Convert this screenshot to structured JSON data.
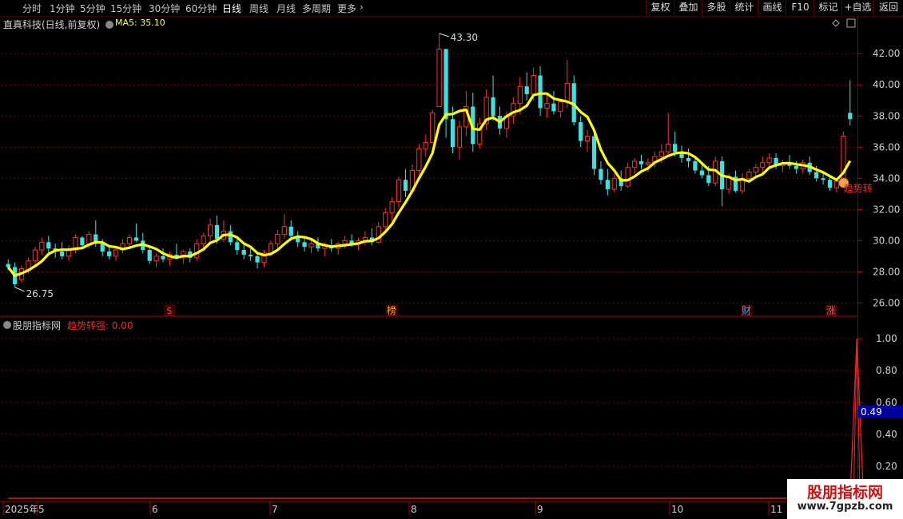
{
  "toolbar": {
    "timeframes": [
      "分时",
      "1分钟",
      "5分钟",
      "15分钟",
      "30分钟",
      "60分钟",
      "日线",
      "周线",
      "月线",
      "多周期",
      "更多"
    ],
    "active_timeframe": "日线",
    "actions": [
      "复权",
      "叠加",
      "多股",
      "统计",
      "画线",
      "F10",
      "标记",
      "+自选",
      "返回"
    ]
  },
  "main_panel": {
    "title": "直真科技(日线,前复权)",
    "ma_label": "MA5: 35.10",
    "high_label": "43.30",
    "low_label": "26.75",
    "markers": [
      {
        "text": "$",
        "color": "#ff3030"
      },
      {
        "text": "榜",
        "color": "#ffaa33"
      },
      {
        "text": "财",
        "color": "#33aaff"
      },
      {
        "text": "涨",
        "color": "#ff5050"
      }
    ],
    "signal_text": "趋势转"
  },
  "sub_panel": {
    "title": "股朋指标网",
    "indicator_label": "趋势转强: 0.00",
    "cursor_value": "0.49"
  },
  "watermark": {
    "title": "股朋指标网",
    "url": "www.7gpzb.com"
  },
  "colors": {
    "up": "#ff3030",
    "down": "#40e0e0",
    "ma": "#ffff00",
    "grid": "#7a0000",
    "axis_text": "#d0d0d0"
  },
  "chart_data": [
    {
      "type": "candlestick",
      "title": "直真科技(日线,前复权)",
      "ylim": [
        25.2,
        43.6
      ],
      "y_ticks": [
        26.0,
        28.0,
        30.0,
        32.0,
        34.0,
        36.0,
        38.0,
        40.0,
        42.0
      ],
      "x_labels": [
        "2025年",
        "5",
        "6",
        "7",
        "8",
        "9",
        "10",
        "11"
      ],
      "ohlc": [
        [
          28.5,
          28.8,
          28.1,
          28.3
        ],
        [
          28.3,
          28.6,
          27.0,
          27.2
        ],
        [
          27.5,
          28.4,
          27.3,
          28.2
        ],
        [
          28.1,
          28.9,
          27.9,
          28.7
        ],
        [
          28.7,
          29.6,
          28.5,
          29.4
        ],
        [
          29.4,
          30.2,
          29.1,
          29.9
        ],
        [
          29.9,
          30.3,
          29.2,
          29.5
        ],
        [
          29.5,
          29.8,
          28.9,
          29.3
        ],
        [
          29.3,
          29.9,
          28.8,
          29.0
        ],
        [
          29.0,
          29.7,
          28.7,
          29.4
        ],
        [
          29.4,
          30.4,
          29.2,
          30.2
        ],
        [
          30.2,
          30.3,
          29.5,
          29.7
        ],
        [
          29.7,
          30.6,
          29.5,
          30.4
        ],
        [
          30.4,
          31.3,
          29.6,
          29.8
        ],
        [
          29.8,
          30.1,
          29.0,
          29.3
        ],
        [
          29.3,
          29.7,
          28.8,
          29.0
        ],
        [
          29.0,
          29.6,
          28.7,
          29.4
        ],
        [
          29.4,
          30.1,
          29.2,
          29.8
        ],
        [
          29.8,
          30.4,
          29.5,
          30.2
        ],
        [
          30.2,
          31.1,
          29.9,
          30.0
        ],
        [
          30.0,
          30.5,
          29.2,
          29.4
        ],
        [
          29.4,
          29.6,
          28.5,
          28.7
        ],
        [
          28.7,
          29.2,
          28.3,
          29.0
        ],
        [
          29.0,
          29.5,
          28.6,
          28.8
        ],
        [
          28.8,
          29.3,
          28.4,
          29.1
        ],
        [
          29.1,
          29.8,
          28.8,
          28.9
        ],
        [
          28.9,
          29.4,
          28.5,
          29.3
        ],
        [
          29.3,
          29.5,
          28.6,
          28.9
        ],
        [
          28.9,
          30.1,
          28.7,
          29.8
        ],
        [
          29.8,
          30.5,
          29.5,
          30.3
        ],
        [
          30.3,
          31.4,
          30.0,
          31.0
        ],
        [
          31.0,
          31.6,
          29.8,
          30.1
        ],
        [
          30.1,
          31.3,
          29.9,
          30.6
        ],
        [
          30.6,
          31.0,
          29.7,
          29.9
        ],
        [
          29.9,
          30.2,
          29.1,
          29.4
        ],
        [
          29.4,
          29.9,
          28.8,
          29.1
        ],
        [
          29.1,
          29.5,
          28.7,
          29.0
        ],
        [
          29.0,
          29.3,
          28.2,
          28.6
        ],
        [
          28.6,
          29.4,
          28.3,
          29.2
        ],
        [
          29.2,
          30.0,
          29.0,
          29.8
        ],
        [
          29.8,
          30.7,
          29.5,
          30.4
        ],
        [
          30.4,
          31.7,
          30.1,
          30.9
        ],
        [
          30.9,
          31.3,
          30.0,
          30.3
        ],
        [
          30.3,
          30.6,
          29.6,
          29.9
        ],
        [
          29.9,
          30.3,
          29.3,
          29.6
        ],
        [
          29.6,
          30.1,
          29.2,
          29.8
        ],
        [
          29.8,
          30.2,
          29.3,
          29.5
        ],
        [
          29.5,
          29.9,
          29.0,
          29.7
        ],
        [
          29.7,
          30.1,
          29.3,
          29.5
        ],
        [
          29.5,
          29.9,
          29.1,
          29.8
        ],
        [
          29.8,
          30.3,
          29.5,
          30.0
        ],
        [
          30.0,
          30.4,
          29.6,
          29.8
        ],
        [
          29.8,
          30.2,
          29.4,
          30.0
        ],
        [
          30.0,
          30.6,
          29.7,
          30.2
        ],
        [
          30.2,
          30.8,
          29.7,
          29.9
        ],
        [
          29.9,
          31.2,
          29.8,
          30.9
        ],
        [
          30.9,
          32.1,
          30.6,
          31.8
        ],
        [
          31.8,
          32.8,
          31.2,
          32.5
        ],
        [
          32.5,
          34.1,
          32.1,
          33.9
        ],
        [
          33.9,
          34.6,
          32.8,
          33.2
        ],
        [
          33.2,
          34.9,
          33.0,
          34.5
        ],
        [
          34.5,
          36.2,
          34.2,
          35.9
        ],
        [
          35.9,
          36.8,
          35.4,
          36.3
        ],
        [
          36.3,
          38.4,
          37.8,
          38.2
        ],
        [
          38.6,
          43.3,
          39.8,
          42.3
        ],
        [
          42.3,
          42.3,
          36.6,
          37.8
        ],
        [
          37.8,
          38.6,
          35.6,
          36.0
        ],
        [
          36.0,
          37.7,
          35.2,
          37.3
        ],
        [
          37.3,
          39.6,
          36.7,
          38.6
        ],
        [
          38.6,
          39.5,
          35.7,
          36.2
        ],
        [
          36.2,
          37.9,
          35.9,
          37.5
        ],
        [
          37.5,
          39.7,
          37.1,
          39.2
        ],
        [
          39.2,
          40.6,
          37.7,
          38.0
        ],
        [
          38.0,
          38.6,
          36.8,
          37.2
        ],
        [
          37.2,
          38.3,
          36.6,
          38.0
        ],
        [
          38.0,
          39.2,
          37.5,
          38.8
        ],
        [
          38.8,
          40.5,
          38.1,
          39.9
        ],
        [
          39.9,
          40.8,
          39.0,
          39.4
        ],
        [
          39.4,
          41.1,
          39.0,
          40.6
        ],
        [
          40.6,
          41.2,
          38.0,
          38.5
        ],
        [
          38.5,
          39.4,
          37.9,
          38.8
        ],
        [
          38.8,
          39.6,
          38.1,
          38.3
        ],
        [
          38.3,
          39.1,
          37.9,
          38.9
        ],
        [
          38.9,
          41.6,
          38.5,
          40.1
        ],
        [
          40.1,
          40.6,
          37.4,
          37.6
        ],
        [
          37.6,
          38.0,
          36.0,
          36.4
        ],
        [
          36.4,
          37.1,
          35.7,
          36.7
        ],
        [
          36.7,
          37.0,
          34.2,
          34.6
        ],
        [
          34.6,
          35.1,
          33.6,
          33.9
        ],
        [
          33.9,
          34.6,
          32.9,
          33.3
        ],
        [
          33.3,
          34.3,
          33.1,
          34.0
        ],
        [
          34.0,
          34.5,
          33.2,
          33.5
        ],
        [
          33.5,
          35.0,
          33.4,
          34.7
        ],
        [
          34.7,
          35.3,
          34.3,
          35.1
        ],
        [
          35.1,
          35.5,
          34.6,
          34.9
        ],
        [
          34.9,
          35.3,
          34.4,
          35.0
        ],
        [
          35.0,
          35.7,
          34.7,
          35.4
        ],
        [
          35.4,
          36.2,
          35.0,
          35.7
        ],
        [
          35.7,
          38.2,
          35.5,
          36.2
        ],
        [
          36.2,
          37.0,
          35.4,
          35.7
        ],
        [
          35.7,
          36.1,
          35.0,
          35.3
        ],
        [
          35.3,
          35.9,
          34.7,
          35.1
        ],
        [
          35.1,
          35.4,
          34.3,
          34.5
        ],
        [
          34.5,
          35.0,
          34.0,
          34.2
        ],
        [
          34.2,
          34.8,
          33.5,
          33.7
        ],
        [
          33.7,
          35.4,
          33.5,
          35.1
        ],
        [
          35.1,
          35.4,
          32.2,
          33.3
        ],
        [
          33.3,
          34.3,
          33.0,
          34.1
        ],
        [
          34.1,
          34.5,
          33.1,
          33.2
        ],
        [
          33.2,
          34.3,
          33.0,
          34.0
        ],
        [
          34.0,
          34.6,
          33.8,
          34.4
        ],
        [
          34.4,
          34.9,
          34.1,
          34.7
        ],
        [
          34.7,
          35.4,
          34.3,
          35.0
        ],
        [
          35.0,
          35.6,
          34.7,
          35.3
        ],
        [
          35.3,
          35.6,
          34.6,
          34.8
        ],
        [
          34.8,
          35.2,
          34.4,
          35.0
        ],
        [
          35.0,
          35.5,
          34.6,
          34.8
        ],
        [
          34.8,
          35.1,
          34.3,
          34.6
        ],
        [
          34.6,
          35.2,
          34.3,
          35.0
        ],
        [
          35.0,
          35.4,
          34.2,
          34.4
        ],
        [
          34.4,
          34.8,
          33.8,
          34.0
        ],
        [
          34.0,
          34.4,
          33.6,
          33.9
        ],
        [
          33.9,
          34.2,
          33.2,
          33.4
        ],
        [
          33.4,
          34.0,
          33.1,
          33.8
        ],
        [
          33.8,
          37.0,
          33.7,
          36.7
        ],
        [
          38.2,
          40.3,
          37.4,
          37.8
        ]
      ],
      "ma5_label": "MA5: 35.10",
      "ma_start": 28.5,
      "ma_end": 35.1
    },
    {
      "type": "line",
      "title": "趋势转强",
      "ylim": [
        0,
        1.1
      ],
      "y_ticks": [
        0.2,
        0.4,
        0.6,
        0.8,
        1.0
      ],
      "values": [
        0,
        0,
        0,
        0,
        0,
        0,
        0,
        0,
        0,
        0,
        0,
        0,
        0,
        0,
        0,
        0,
        0,
        0,
        0,
        0,
        0,
        0,
        0,
        0,
        0,
        0,
        0,
        0,
        0,
        0,
        0,
        0,
        0,
        0,
        0,
        0,
        0,
        0,
        0,
        0,
        0,
        0,
        0,
        0,
        0,
        0,
        0,
        0,
        0,
        0,
        0,
        0,
        0,
        0,
        0,
        0,
        0,
        0,
        0,
        0,
        0,
        0,
        0,
        0,
        0,
        0,
        0,
        0,
        0,
        0,
        0,
        0,
        0,
        0,
        0,
        0,
        0,
        0,
        0,
        0,
        0,
        0,
        0,
        0,
        0,
        0,
        0,
        0,
        0,
        0,
        0,
        0,
        0,
        0,
        0,
        0,
        0,
        0,
        0,
        0,
        0,
        0,
        0,
        0,
        0,
        0,
        0,
        0,
        0,
        0,
        0,
        0,
        0,
        0,
        0,
        0,
        0,
        0,
        0,
        0,
        0,
        0,
        0,
        0,
        0,
        0,
        1,
        0
      ]
    }
  ]
}
